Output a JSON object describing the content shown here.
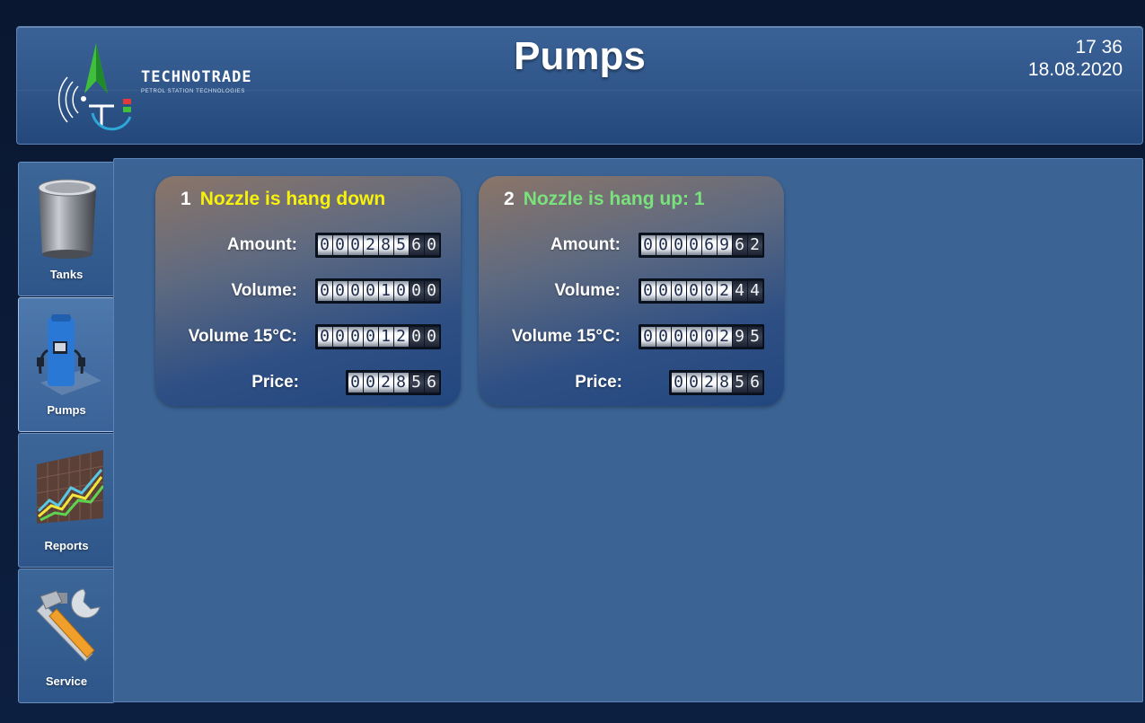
{
  "header": {
    "brand": "TECHNOTRADE",
    "brand_sub": "PETROL STATION TECHNOLOGIES",
    "title": "Pumps",
    "time": "17 36",
    "date": "18.08.2020"
  },
  "sidebar": {
    "items": [
      {
        "label": "Tanks",
        "icon": "tank-icon",
        "active": false
      },
      {
        "label": "Pumps",
        "icon": "fuel-pump-icon",
        "active": true
      },
      {
        "label": "Reports",
        "icon": "chart-icon",
        "active": false
      },
      {
        "label": "Service",
        "icon": "tools-icon",
        "active": false
      }
    ]
  },
  "labels": {
    "amount": "Amount:",
    "volume": "Volume:",
    "volume15": "Volume 15°C:",
    "price": "Price:"
  },
  "pumps": [
    {
      "number": "1",
      "status": "Nozzle is hang down",
      "status_color": "#f7f20c",
      "amount": {
        "white": "000285",
        "black": "60"
      },
      "volume": {
        "white": "000010",
        "black": "00"
      },
      "volume15": {
        "white": "000012",
        "black": "00"
      },
      "price": {
        "white": "0028",
        "black": "56"
      }
    },
    {
      "number": "2",
      "status": "Nozzle is hang up: 1",
      "status_color": "#79e27d",
      "amount": {
        "white": "000069",
        "black": "62"
      },
      "volume": {
        "white": "000002",
        "black": "44"
      },
      "volume15": {
        "white": "000002",
        "black": "95"
      },
      "price": {
        "white": "0028",
        "black": "56"
      }
    }
  ],
  "colors": {
    "background": "#3b6394",
    "header": "#2f5589"
  }
}
